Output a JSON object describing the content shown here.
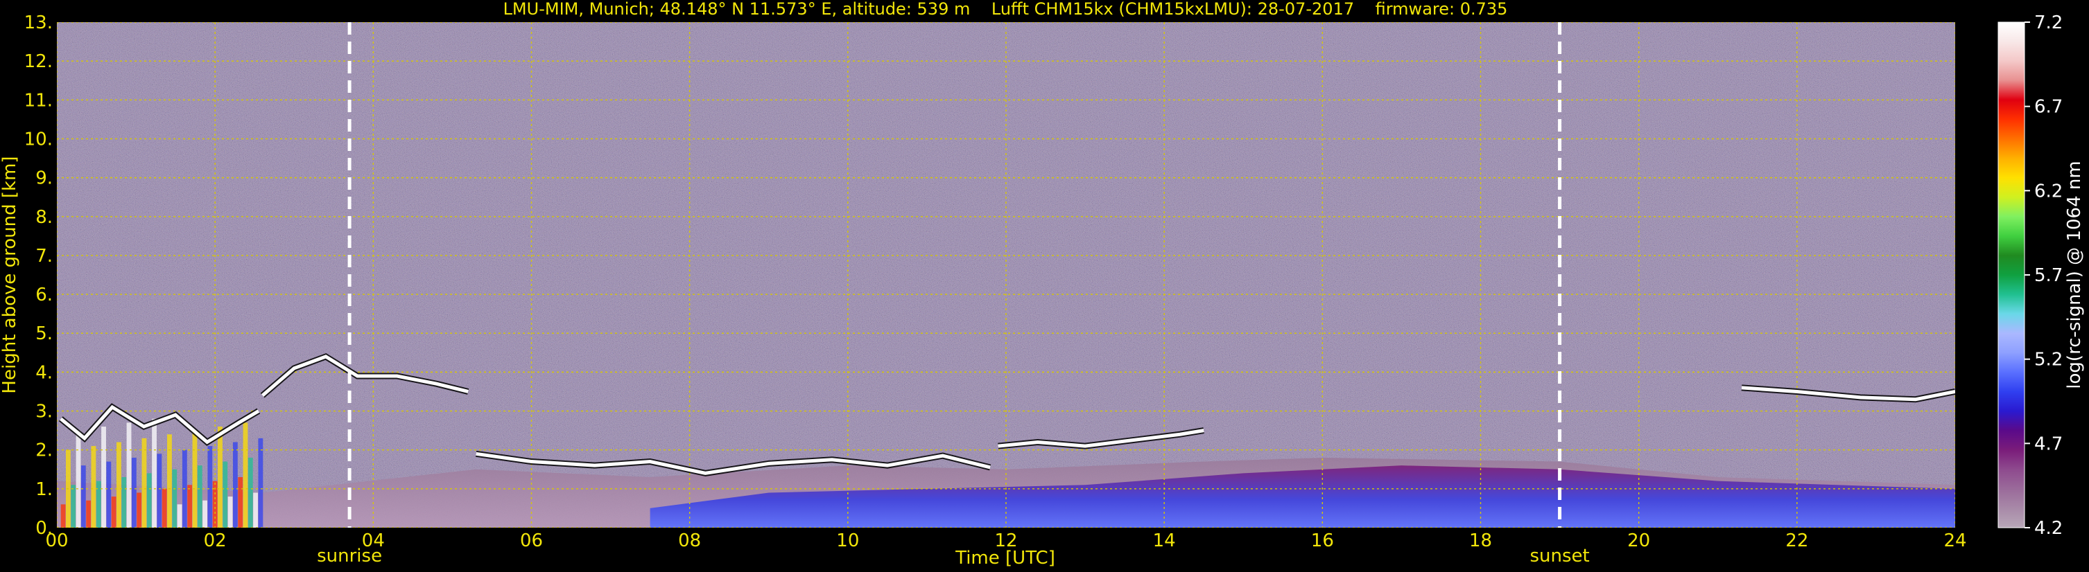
{
  "chart_data": {
    "type": "heatmap",
    "title": "LMU-MIM, Munich; 48.148° N 11.573° E, altitude: 539 m    Lufft CHM15kx (CHM15kxLMU): 28-07-2017    firmware: 0.735",
    "xlabel": "Time [UTC]",
    "ylabel": "Height above ground [km]",
    "xlim": [
      0,
      24
    ],
    "ylim": [
      0,
      13
    ],
    "x_ticks": [
      "00",
      "02",
      "04",
      "06",
      "08",
      "10",
      "12",
      "14",
      "16",
      "18",
      "20",
      "22",
      "24"
    ],
    "y_ticks": [
      "0.",
      "1.",
      "2.",
      "3.",
      "4.",
      "5.",
      "6.",
      "7.",
      "8.",
      "9.",
      "10.",
      "11.",
      "12.",
      "13."
    ],
    "grid": true,
    "markers": [
      {
        "label": "sunrise",
        "x": 3.7
      },
      {
        "label": "sunset",
        "x": 19.0
      }
    ],
    "colorbar": {
      "label": "log(rc-signal) @ 1064 nm",
      "range": [
        4.2,
        7.2
      ],
      "ticks": [
        "4.2",
        "4.7",
        "5.2",
        "5.7",
        "6.2",
        "6.7",
        "7.2"
      ],
      "colors": [
        "#b8a8b8",
        "#a889a8",
        "#9a6a9a",
        "#8e4a8e",
        "#7a1c7a",
        "#5a0a8a",
        "#2a1ad0",
        "#3040f0",
        "#5a70ff",
        "#8ea0ff",
        "#aab8ff",
        "#6ad8e8",
        "#20c090",
        "#10a040",
        "#208a20",
        "#40d040",
        "#80f060",
        "#d0f020",
        "#ffe000",
        "#ffb000",
        "#ff7000",
        "#ff3000",
        "#e00010",
        "#e89090",
        "#f4c8c8",
        "#f8e8e8",
        "#ffffff"
      ]
    },
    "cloud_layers": [
      {
        "x": [
          0.05,
          0.35,
          0.7,
          1.1,
          1.5,
          1.9,
          2.3,
          2.55
        ],
        "y": [
          2.8,
          2.3,
          3.1,
          2.6,
          2.9,
          2.2,
          2.7,
          3.0
        ]
      },
      {
        "x": [
          2.6,
          3.0,
          3.4,
          3.8,
          4.3,
          4.8,
          5.2
        ],
        "y": [
          3.4,
          4.1,
          4.4,
          3.9,
          3.9,
          3.7,
          3.5
        ]
      },
      {
        "x": [
          5.3,
          6.0,
          6.8,
          7.5,
          8.2,
          9.0,
          9.8,
          10.5,
          11.2,
          11.8
        ],
        "y": [
          1.9,
          1.7,
          1.6,
          1.7,
          1.4,
          1.65,
          1.75,
          1.6,
          1.85,
          1.55
        ]
      },
      {
        "x": [
          11.9,
          12.4,
          13.0,
          13.6,
          14.2,
          14.5
        ],
        "y": [
          2.1,
          2.2,
          2.1,
          2.25,
          2.4,
          2.5
        ]
      },
      {
        "x": [
          21.3,
          22.0,
          22.8,
          23.5,
          24.0
        ],
        "y": [
          3.6,
          3.5,
          3.35,
          3.3,
          3.5
        ]
      }
    ],
    "aerosol_layer_top_km": [
      {
        "x": [
          0.0,
          2.6,
          5.3,
          7.5,
          10.0,
          12.0,
          14.5,
          16.0,
          19.0,
          21.0,
          24.0
        ],
        "y": [
          1.2,
          0.9,
          1.5,
          1.3,
          1.6,
          1.5,
          1.7,
          1.8,
          1.7,
          1.3,
          1.1
        ]
      }
    ]
  }
}
